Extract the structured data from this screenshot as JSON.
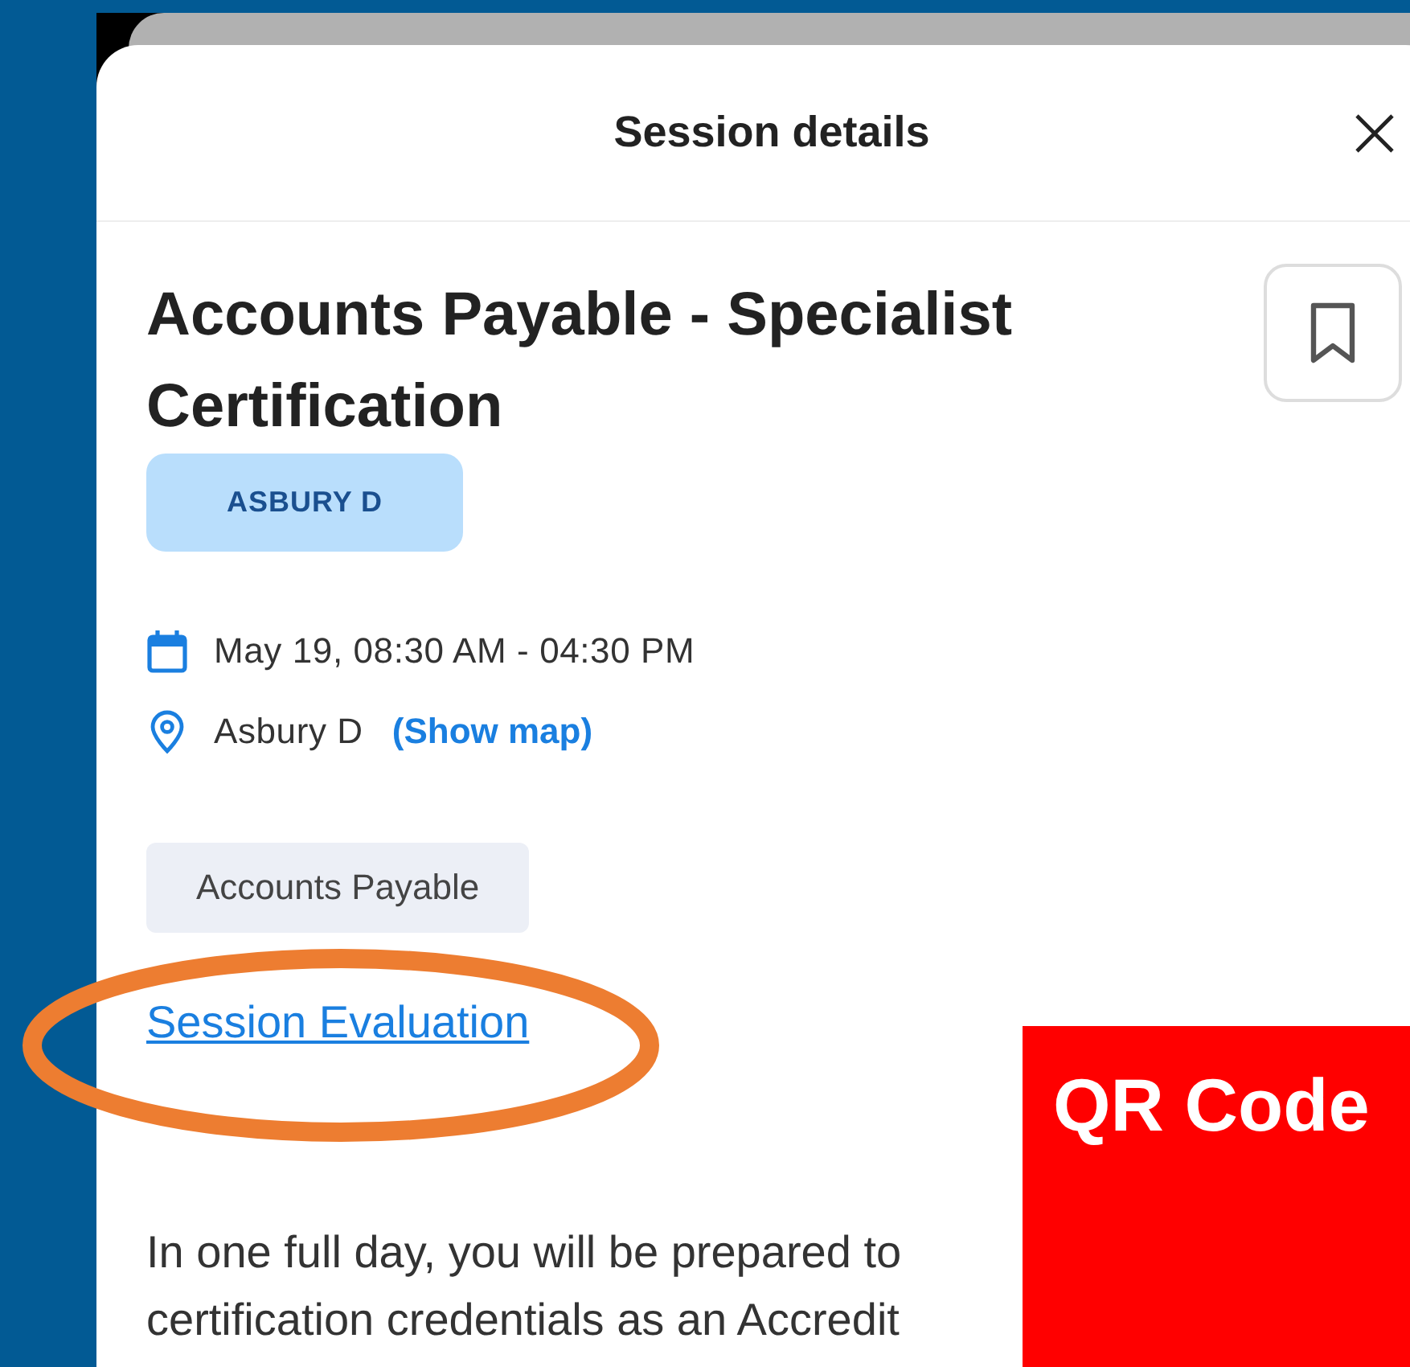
{
  "header": {
    "title": "Session details"
  },
  "session": {
    "title": "Accounts Payable - Specialist Certification",
    "room_tag": "ASBURY D",
    "date_time": "May 19, 08:30 AM - 04:30 PM",
    "location": "Asbury D",
    "map_link": "(Show map)"
  },
  "category_tags": [
    "Accounts Payable"
  ],
  "evaluation_link": "Session Evaluation",
  "description_lines": [
    "In one full day, you will be prepared to",
    "certification credentials as an Accredit"
  ],
  "annotations": [
    {
      "kind": "ellipse"
    },
    {
      "kind": "box",
      "label": "QR Code"
    }
  ]
}
